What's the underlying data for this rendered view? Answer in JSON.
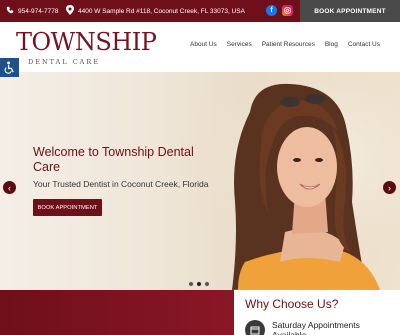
{
  "topbar": {
    "phone": "954-974-7778",
    "address": "4400 W Sample Rd #118, Coconut Creek, FL 33073, USA",
    "book_label": "BOOK APPOINTMENT",
    "social": [
      "facebook-icon",
      "instagram-icon"
    ],
    "colors": {
      "background": "#6e0f1a",
      "button": "#4a4a4a"
    }
  },
  "logo": {
    "main": "TOWNSHIP",
    "sub": "DENTAL CARE"
  },
  "nav": [
    "About Us",
    "Services",
    "Patient Resources",
    "Blog",
    "Contact Us"
  ],
  "hero": {
    "title": "Welcome to Township Dental Care",
    "subtitle": "Your Trusted Dentist in Coconut Creek, Florida",
    "button": "BOOK APPOINTMENT",
    "slides": 3,
    "active_slide": 2
  },
  "why": {
    "heading": "Why Choose Us?",
    "item": "Saturday Appointments Available"
  },
  "colors": {
    "brand": "#6e0f1a"
  }
}
